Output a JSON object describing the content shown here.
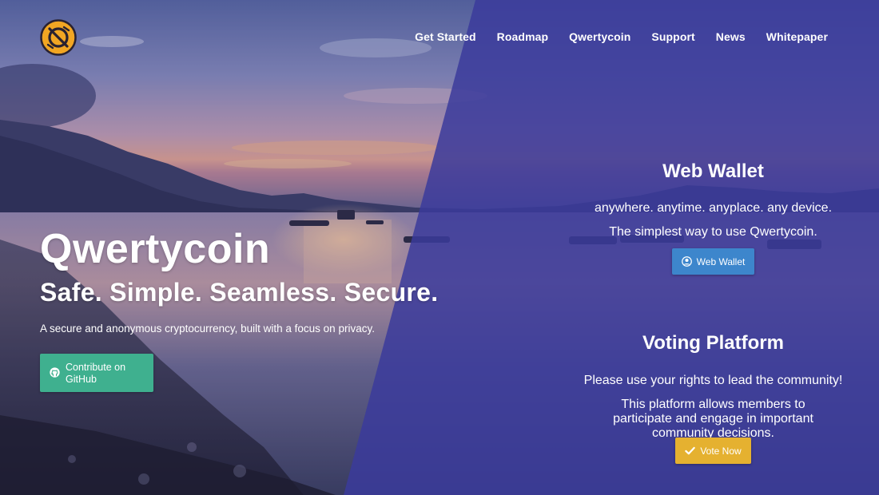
{
  "nav": {
    "items": [
      "Get Started",
      "Roadmap",
      "Qwertycoin",
      "Support",
      "News",
      "Whitepaper"
    ]
  },
  "hero": {
    "title": "Qwertycoin",
    "tagline": "Safe. Simple. Seamless. Secure.",
    "description": "A secure and anonymous cryptocurrency, built with a focus on privacy.",
    "github_button": "Contribute on GitHub"
  },
  "wallet": {
    "title": "Web Wallet",
    "subtitle": "anywhere. anytime. anyplace. any device.",
    "text": "The simplest way to use Qwertycoin.",
    "button": "Web Wallet"
  },
  "voting": {
    "title": "Voting Platform",
    "subtitle": "Please use your rights to lead the community!",
    "text": "This platform allows members to participate and engage in important community decisions.",
    "button": "Vote Now"
  },
  "colors": {
    "overlay": "#3a3a9a",
    "github_button": "#3fb08f",
    "wallet_button": "#3d86cc",
    "vote_button": "#e5b130",
    "logo": "#f2a623"
  },
  "icons": {
    "logo": "qwertycoin-logo-icon",
    "github": "github-icon",
    "wallet": "user-circle-icon",
    "vote": "check-icon"
  }
}
